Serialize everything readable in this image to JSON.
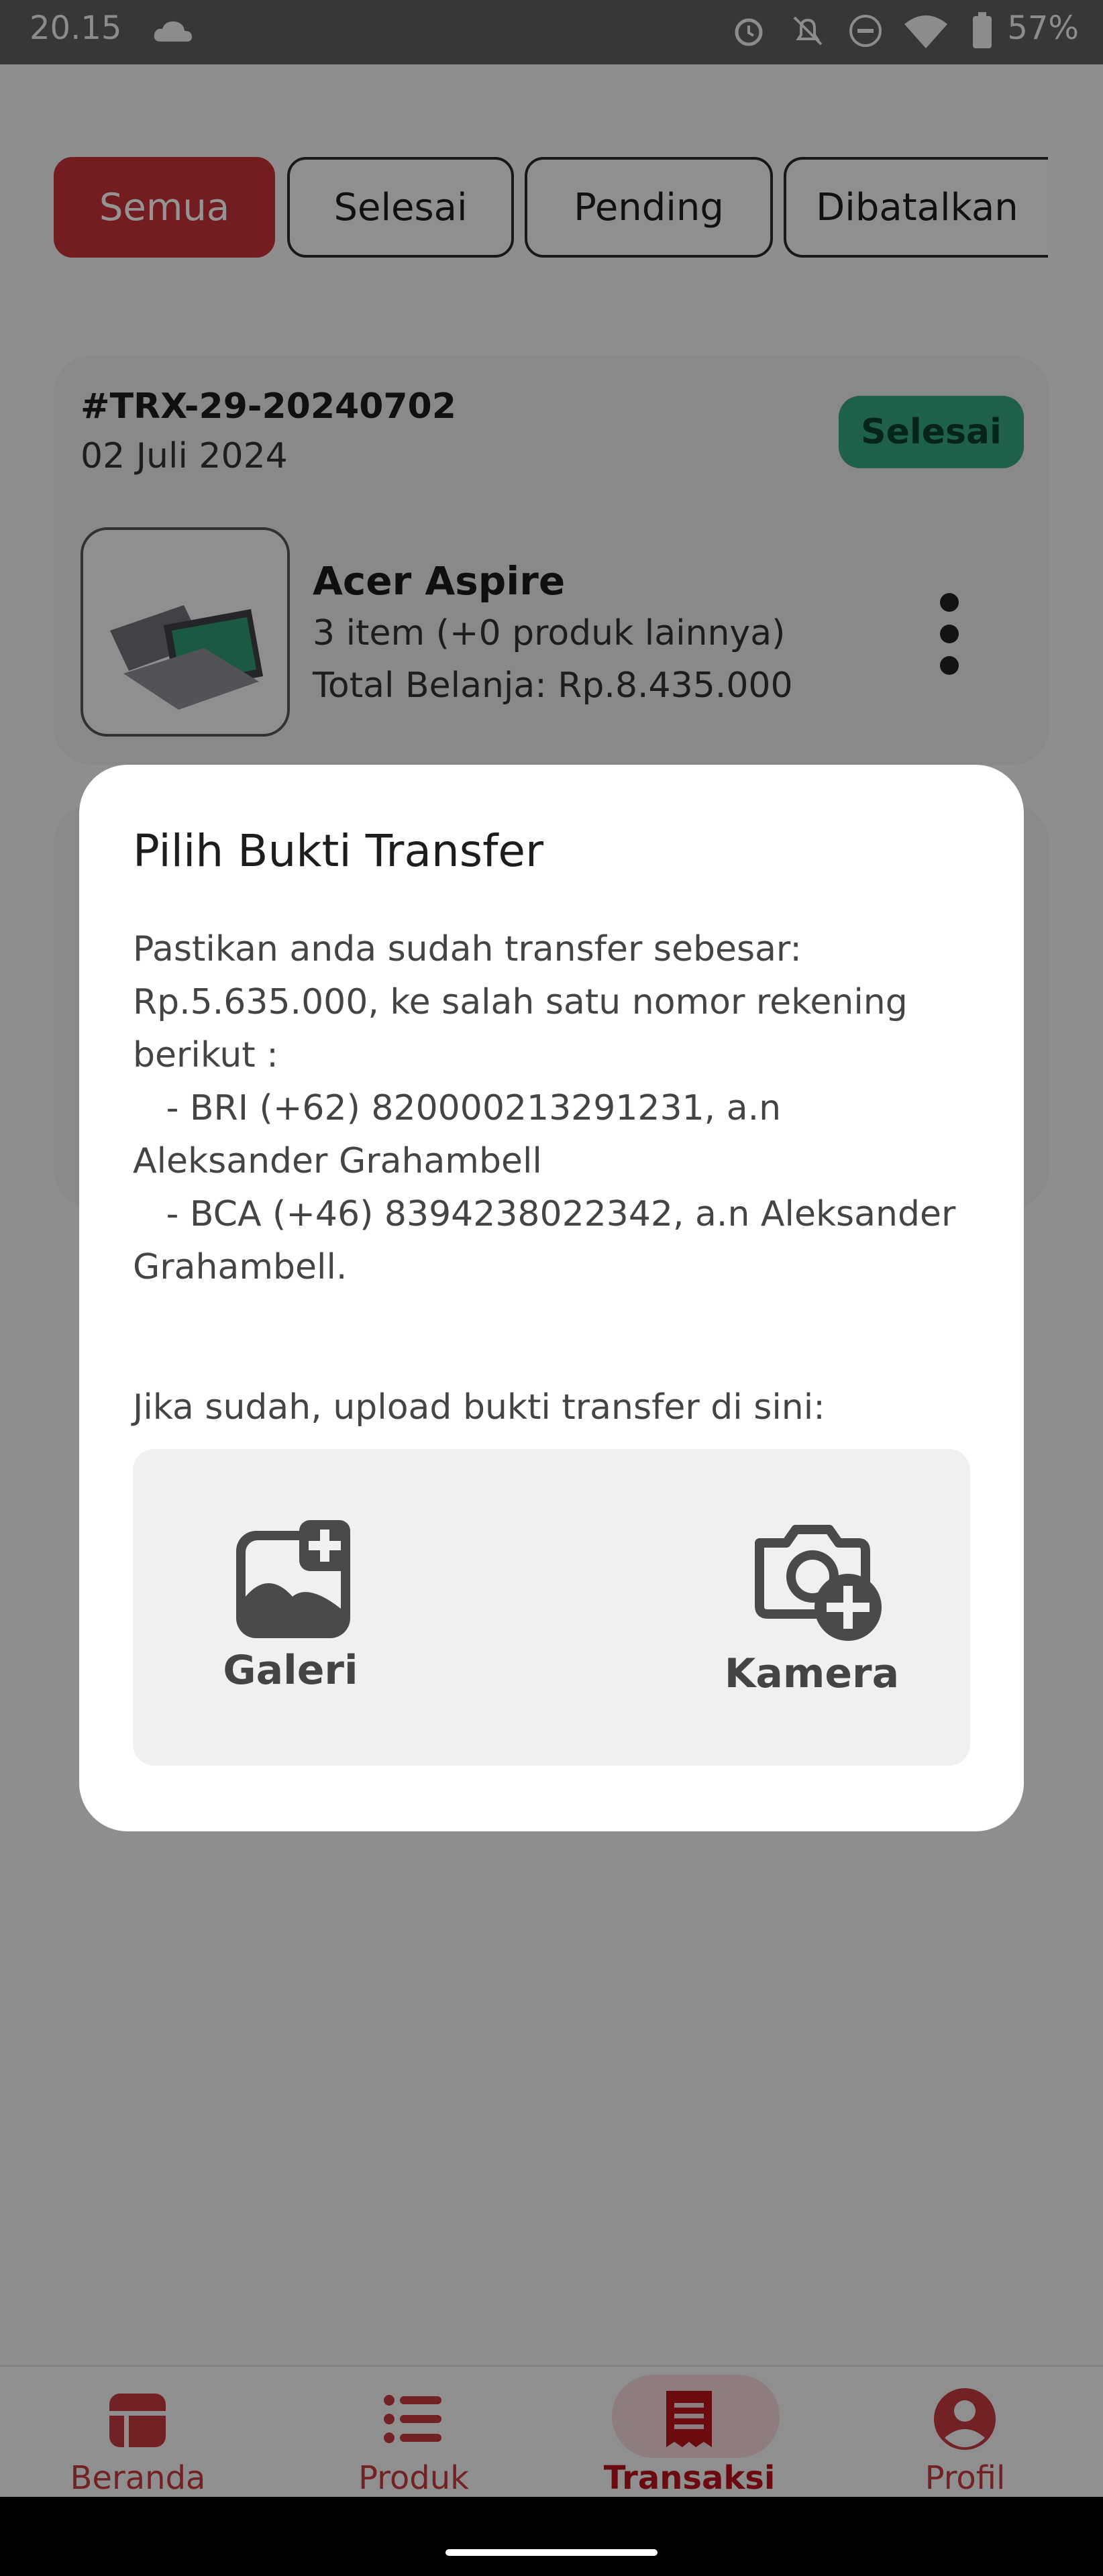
{
  "status_bar": {
    "time": "20.15",
    "battery": "57%"
  },
  "tabs": [
    "Semua",
    "Selesai",
    "Pending",
    "Dibatalkan"
  ],
  "transaction": {
    "id": "#TRX-29-20240702",
    "date": "02 Juli 2024",
    "status": "Selesai",
    "product_name": "Acer Aspire",
    "items": "3 item (+0 produk lainnya)",
    "total": "Total Belanja: Rp.8.435.000"
  },
  "dialog": {
    "title": "Pilih Bukti Transfer",
    "body": "Pastikan anda sudah transfer sebesar: Rp.5.635.000, ke salah satu nomor rekening berikut :\n   - BRI (+62) 820000213291231, a.n Aleksander Grahambell\n   - BCA (+46) 8394238022342, a.n Aleksander Grahambell.",
    "prompt": "Jika sudah, upload bukti transfer di sini:",
    "gallery_label": "Galeri",
    "camera_label": "Kamera"
  },
  "bottom_nav": [
    {
      "label": "Beranda",
      "icon": "home-icon"
    },
    {
      "label": "Produk",
      "icon": "list-icon"
    },
    {
      "label": "Transaksi",
      "icon": "receipt-icon",
      "active": true
    },
    {
      "label": "Profil",
      "icon": "profile-icon"
    }
  ],
  "colors": {
    "primary": "#c7323a",
    "success": "#35a77c"
  }
}
